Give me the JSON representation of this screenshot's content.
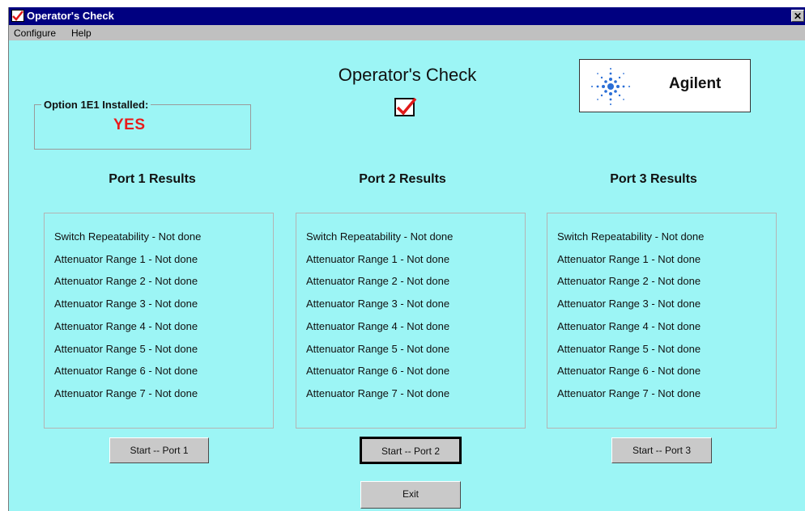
{
  "window": {
    "title": "Operator's Check",
    "close_glyph": "✕"
  },
  "menu": {
    "items": [
      "Configure",
      "Help"
    ]
  },
  "app_title": "Operator's Check",
  "logo": {
    "text": "Agilent",
    "icon": "agilent-spark-logo"
  },
  "option": {
    "label": "Option 1E1 Installed:",
    "value": "YES"
  },
  "ports": [
    {
      "header": "Port 1 Results",
      "results": [
        "Switch Repeatability - Not done",
        "Attenuator Range 1 - Not done",
        "Attenuator Range 2 - Not done",
        "Attenuator Range 3 - Not done",
        "Attenuator Range 4 - Not done",
        "Attenuator Range 5 - Not done",
        "Attenuator Range 6 - Not done",
        "Attenuator Range 7 - Not done"
      ],
      "button": "Start -- Port 1"
    },
    {
      "header": "Port 2 Results",
      "results": [
        "Switch Repeatability - Not done",
        "Attenuator Range 1 - Not done",
        "Attenuator Range 2 - Not done",
        "Attenuator Range 3 - Not done",
        "Attenuator Range 4 - Not done",
        "Attenuator Range 5 - Not done",
        "Attenuator Range 6 - Not done",
        "Attenuator Range 7 - Not done"
      ],
      "button": "Start -- Port 2"
    },
    {
      "header": "Port 3 Results",
      "results": [
        "Switch Repeatability - Not done",
        "Attenuator Range 1 - Not done",
        "Attenuator Range 2 - Not done",
        "Attenuator Range 3 - Not done",
        "Attenuator Range 4 - Not done",
        "Attenuator Range 5 - Not done",
        "Attenuator Range 6 - Not done",
        "Attenuator Range 7 - Not done"
      ],
      "button": "Start -- Port 3"
    }
  ],
  "exit_button": "Exit",
  "colors": {
    "background": "#9cf5f5",
    "titlebar": "#000080",
    "status_red": "#e81c1c",
    "check_red": "#e01818"
  }
}
